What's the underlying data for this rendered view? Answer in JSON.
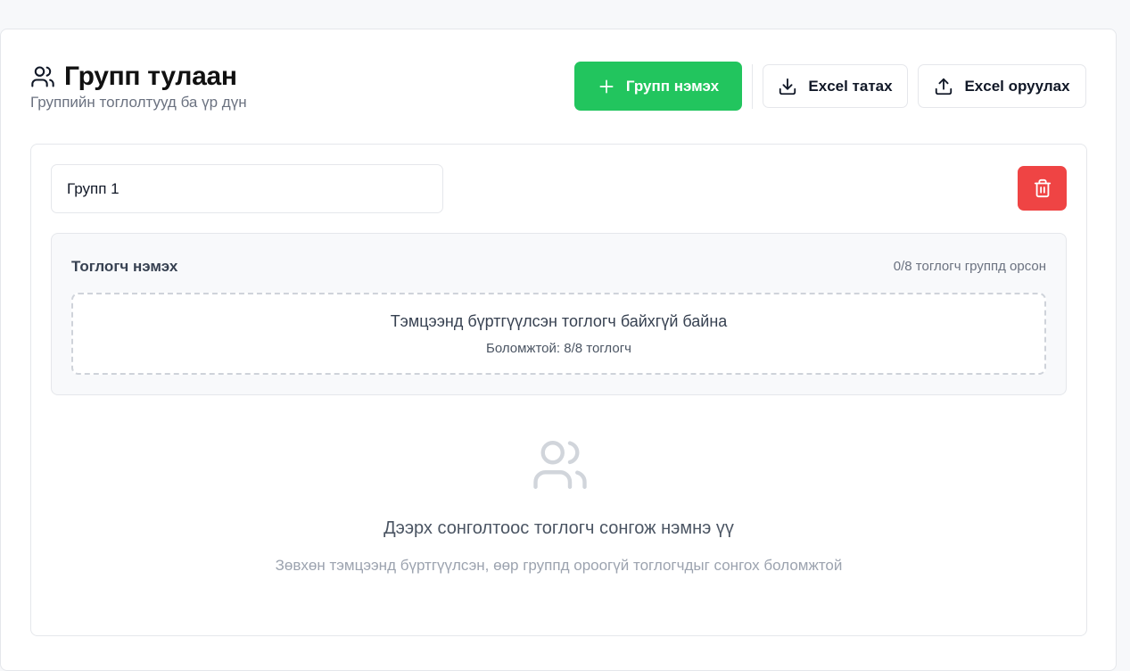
{
  "header": {
    "title": "Групп тулаан",
    "subtitle": "Группийн тоглолтууд ба үр дүн",
    "title_icon": "users-icon"
  },
  "actions": {
    "add_group_label": "Групп нэмэх",
    "excel_download_label": "Excel татах",
    "excel_upload_label": "Excel оруулах"
  },
  "group": {
    "name_value": "Групп 1",
    "delete_icon": "trash-icon",
    "add_player": {
      "title": "Тоглогч нэмэх",
      "count_text": "0/8 тоглогч группд орсон",
      "empty_message": "Тэмцээнд бүртгүүлсэн тоглогч байхгүй байна",
      "available_text": "Боломжтой: 8/8 тоглогч"
    },
    "empty_state": {
      "icon": "users-icon",
      "message": "Дээрх сонголтоос тоглогч сонгож нэмнэ үү",
      "hint": "Зөвхөн тэмцээнд бүртгүүлсэн, өөр группд ороогүй тоглогчдыг сонгох боломжтой"
    }
  },
  "colors": {
    "primary": "#22c55e",
    "danger": "#ef4444",
    "border": "#e5e7eb"
  }
}
